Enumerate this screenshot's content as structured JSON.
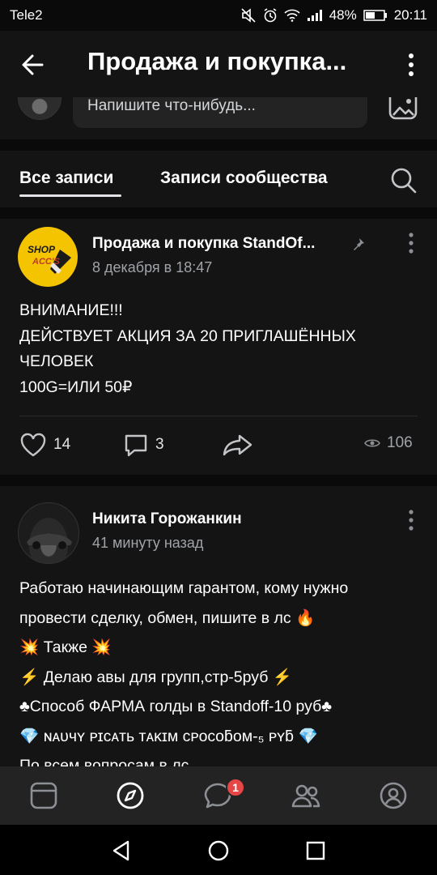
{
  "status_bar": {
    "carrier": "Tele2",
    "battery": "48%",
    "time": "20:11"
  },
  "header": {
    "title": "Продажа и покупка..."
  },
  "composer": {
    "placeholder": "Напишите что-нибудь..."
  },
  "tabs": {
    "all_posts": "Все записи",
    "community_posts": "Записи сообщества"
  },
  "posts": [
    {
      "author": "Продажа и покупка StandOf...",
      "date": "8 декабря в 18:47",
      "avatar_text": "SHOP ACC'S",
      "text": "ВНИМАНИЕ!!!\nДЕЙСТВУЕТ АКЦИЯ ЗА 20 ПРИГЛАШЁННЫХ ЧЕЛОВЕК\n100G=ИЛИ 50₽",
      "likes": "14",
      "comments": "3",
      "views": "106"
    },
    {
      "author": "Никита Горожанкин",
      "date": "41 минуту назад",
      "text_lines": [
        "Работаю начинающим гарантом, кому нужно",
        "провести сделку, обмен, пишите в лс 🔥",
        "💥 Также 💥",
        "⚡ Делаю авы для групп,стр-5руб ⚡",
        "♣Способ ФАРМА голды в Standoff-10 руб♣",
        "💎 ɴᴀᴜчʏ ᴘɪᴄᴀᴛь ᴛᴀᴋɪᴍ ᴄᴘᴏᴄᴏƃᴏᴍ-₅ ᴘʏƃ 💎",
        "По всем вопросам в лс"
      ]
    }
  ],
  "bottom_nav": {
    "messages_badge": "1"
  },
  "colors": {
    "background": "#0a0a0a",
    "surface": "#141414",
    "nav": "#232324",
    "badge": "#e64646",
    "secondary_text": "#a0a3a8"
  }
}
